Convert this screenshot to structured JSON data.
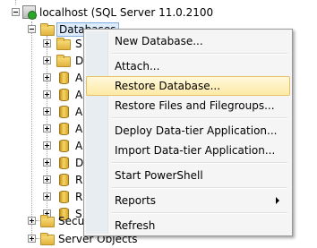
{
  "tree": {
    "server": {
      "label": "localhost (SQL Server 11.0.2100",
      "icon": "server-icon"
    },
    "databases": {
      "label": "Databases",
      "icon": "folder-icon"
    },
    "children": [
      {
        "text": "S",
        "icon": "folder-icon"
      },
      {
        "text": "D",
        "icon": "folder-icon"
      },
      {
        "text": "A",
        "icon": "database-icon"
      },
      {
        "text": "A",
        "icon": "database-icon"
      },
      {
        "text": "A",
        "icon": "database-icon"
      },
      {
        "text": "A",
        "icon": "database-icon"
      },
      {
        "text": "A",
        "icon": "database-icon"
      },
      {
        "text": "D",
        "icon": "database-icon"
      },
      {
        "text": "R",
        "icon": "database-icon"
      },
      {
        "text": "R",
        "icon": "database-icon"
      },
      {
        "text": "S",
        "icon": "database-icon"
      },
      {
        "text": "S",
        "icon": "database-icon"
      }
    ],
    "security": {
      "label": "Secu",
      "icon": "folder-icon"
    },
    "server_objects": {
      "label": "Server Objects",
      "icon": "folder-icon"
    }
  },
  "context_menu": {
    "items": [
      {
        "label": "New Database..."
      },
      {
        "label": "Attach..."
      },
      {
        "label": "Restore Database...",
        "highlighted": true
      },
      {
        "label": "Restore Files and Filegroups..."
      },
      {
        "label": "Deploy Data-tier Application..."
      },
      {
        "label": "Import Data-tier Application..."
      },
      {
        "label": "Start PowerShell"
      },
      {
        "label": "Reports",
        "submenu": true
      },
      {
        "label": "Refresh"
      }
    ]
  }
}
